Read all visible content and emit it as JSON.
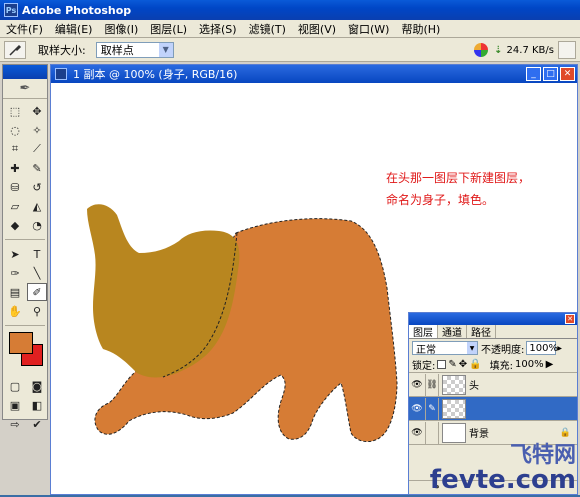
{
  "app": {
    "title": "Adobe Photoshop"
  },
  "menu": [
    "文件(F)",
    "编辑(E)",
    "图像(I)",
    "图层(L)",
    "选择(S)",
    "滤镜(T)",
    "视图(V)",
    "窗口(W)",
    "帮助(H)"
  ],
  "options": {
    "tool_icon": "eyedropper-icon",
    "sample_size_label": "取样大小:",
    "sample_size_value": "取样点",
    "net_speed": "24.7 KB/s"
  },
  "document": {
    "title": "1 副本 @ 100% (身子, RGB/16)",
    "note_lines": [
      "在头那一图层下新建图层，",
      "命名为身子，填色。"
    ],
    "colors": {
      "head": "#b8861f",
      "body": "#d67c35"
    }
  },
  "toolbox": {
    "foreground_color": "#d67c35",
    "background_color": "#e02020"
  },
  "layers_panel": {
    "tabs": [
      "图层",
      "通道",
      "路径"
    ],
    "blend_mode": "正常",
    "opacity_label": "不透明度:",
    "opacity_value": "100%",
    "lock_label": "锁定:",
    "fill_label": "填充:",
    "fill_value": "100%",
    "layers": [
      {
        "name": "头",
        "selected": false,
        "visible": true
      },
      {
        "name": "",
        "selected": true,
        "visible": true
      },
      {
        "name": "背景",
        "selected": false,
        "visible": true,
        "locked": true
      }
    ]
  },
  "watermark": {
    "logo": "飞特网",
    "url": "fevte.com"
  }
}
